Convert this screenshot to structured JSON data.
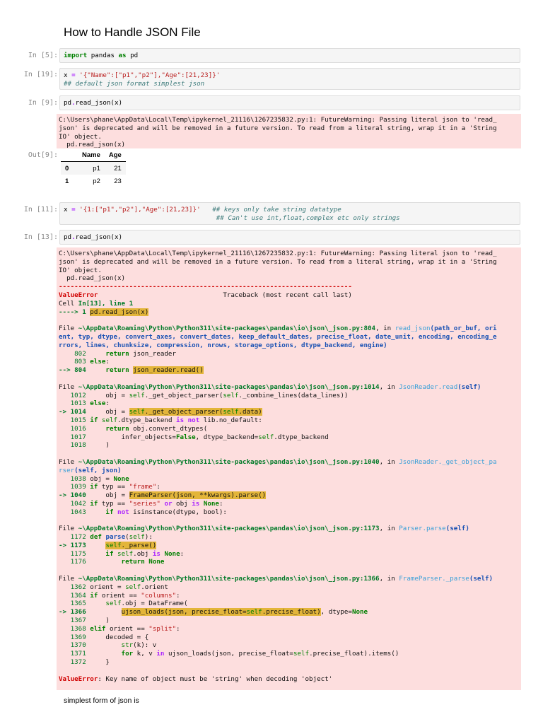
{
  "title": "How to Handle JSON File",
  "cells": {
    "c1": {
      "prompt": "In [5]:",
      "code": [
        "import",
        " pandas ",
        "as",
        " pd"
      ]
    },
    "c2": {
      "prompt": "In [19]:"
    },
    "c3": {
      "prompt": "In [9]:",
      "code": "pd.read_json(x)"
    },
    "c3_out": {
      "prompt": "Out[9]:"
    },
    "c4": {
      "prompt": "In [11]:"
    },
    "c5": {
      "prompt": "In [13]:",
      "code": "pd.read_json(x)"
    }
  },
  "warning1": "C:\\Users\\phane\\AppData\\Local\\Temp\\ipykernel_21116\\1267235832.py:1: FutureWarning: Passing literal json to 'read_\njson' is deprecated and will be removed in a future version. To read from a literal string, wrap it in a 'String\nIO' object.\n  pd.read_json(x)",
  "warning2": "C:\\Users\\phane\\AppData\\Local\\Temp\\ipykernel_21116\\1267235832.py:1: FutureWarning: Passing literal json to 'read_\njson' is deprecated and will be removed in a future version. To read from a literal string, wrap it in a 'String\nIO' object.\n  pd.read_json(x)",
  "table": {
    "columns": [
      "",
      "Name",
      "Age"
    ],
    "rows": [
      [
        "0",
        "p1",
        "21"
      ],
      [
        "1",
        "p2",
        "23"
      ]
    ]
  },
  "final_error": "Key name of object must be 'string' when decoding 'object'",
  "markdown_text": "simplest form of json is"
}
